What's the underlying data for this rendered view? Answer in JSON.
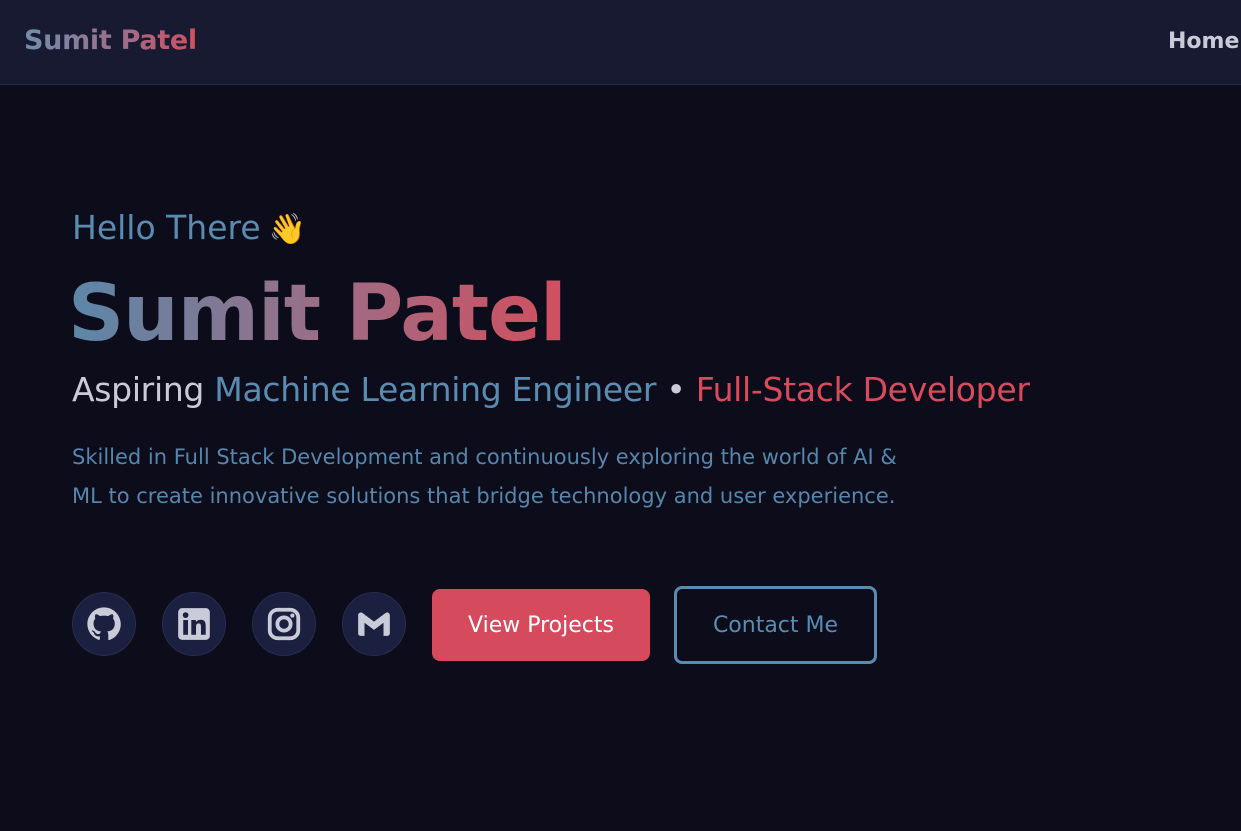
{
  "nav": {
    "brand": "Sumit Patel",
    "links": [
      {
        "label": "Home"
      }
    ]
  },
  "hero": {
    "greeting": "Hello There",
    "wave_emoji": "👋",
    "name": "Sumit Patel",
    "role": {
      "prefix": "Aspiring ",
      "primary": "Machine Learning Engineer",
      "separator": " • ",
      "secondary": "Full-Stack Developer"
    },
    "bio": "Skilled in Full Stack Development and continuously exploring the world of AI & ML to create innovative solutions that bridge technology and user experience.",
    "socials": [
      {
        "icon": "github-icon"
      },
      {
        "icon": "linkedin-icon"
      },
      {
        "icon": "instagram-icon"
      },
      {
        "icon": "gmail-icon"
      }
    ],
    "buttons": {
      "primary": "View Projects",
      "secondary": "Contact Me"
    }
  },
  "colors": {
    "background": "#0c0c1b",
    "navbar": "#171a31",
    "accent_blue": "#5a8cb1",
    "accent_red": "#d54b5d",
    "text_light": "#c9ccd8",
    "social_bg": "#1c2040"
  }
}
